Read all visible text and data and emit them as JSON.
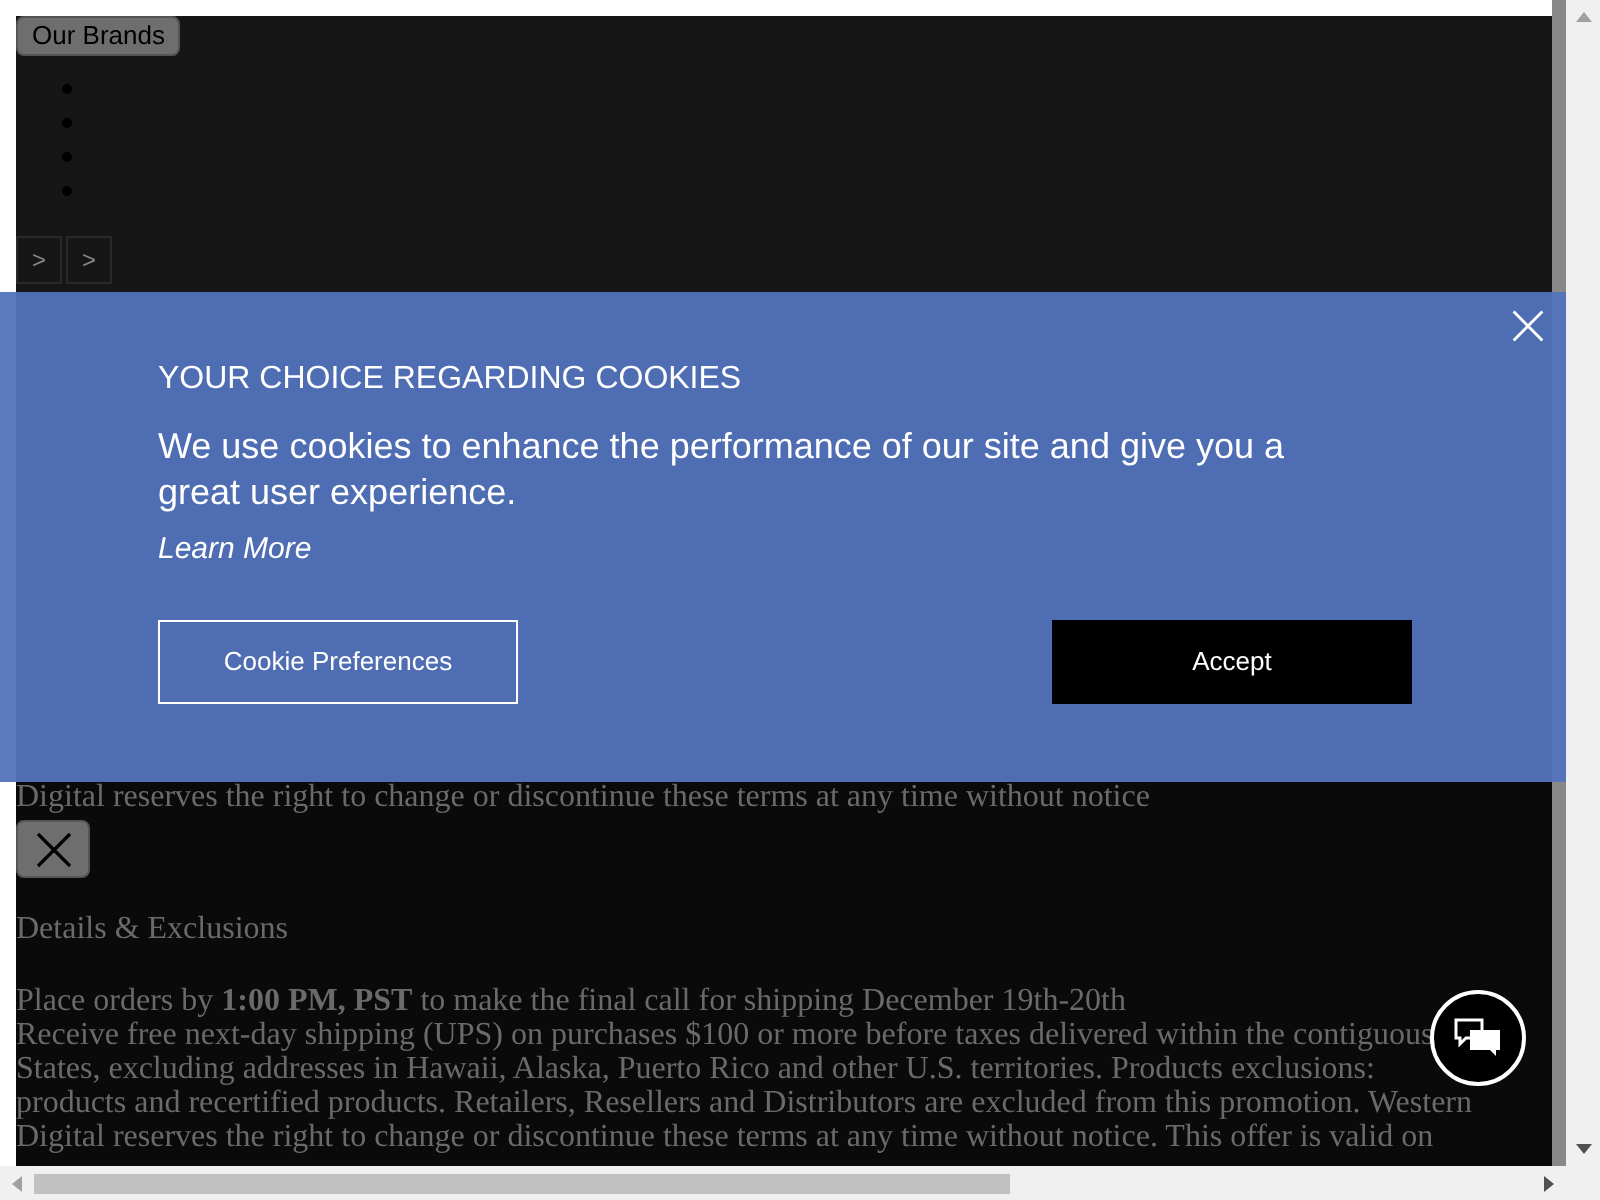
{
  "header": {
    "brands_button": "Our Brands",
    "bullet_count_items": [
      {
        "kind": "bullet"
      },
      {
        "kind": "bullet"
      },
      {
        "kind": "bullet"
      },
      {
        "kind": "bullet"
      }
    ],
    "arrows": [
      ">",
      ">"
    ]
  },
  "page": {
    "notice": "Digital reserves the right to change or discontinue these terms at any time without notice",
    "heading": "Details & Exclusions",
    "lines": [
      "Place orders by **1:00 PM, PST** to make the final call for shipping December 19th-20th",
      "Receive free next-day shipping (UPS) on purchases $100 or more before taxes delivered within the contiguous",
      "States, excluding addresses in Hawaii, Alaska, Puerto Rico and other U.S. territories. Products exclusions:",
      "products and recertified products. Retailers, Resellers and Distributors are excluded from this promotion. Western",
      "Digital reserves the right to change or discontinue these terms at any time without notice. This offer is valid on"
    ]
  },
  "cookie_banner": {
    "title": "YOUR CHOICE REGARDING COOKIES",
    "message": "We use cookies to enhance the performance of our site and give you a great user experience.",
    "link": "Learn More",
    "buttons": [
      {
        "label": "Cookie Preferences",
        "kind": "outline"
      },
      {
        "label": "Accept",
        "kind": "solid"
      }
    ]
  }
}
